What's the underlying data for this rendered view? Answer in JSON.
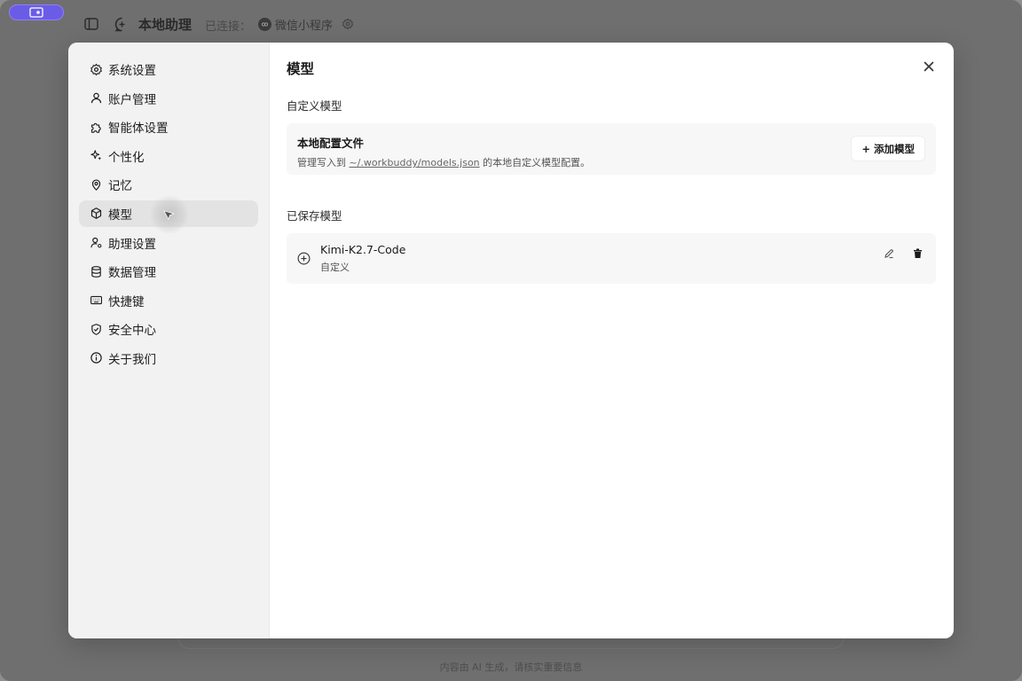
{
  "app": {
    "title": "本地助理",
    "connection_label": "已连接：",
    "connected_app": "微信小程序",
    "footer_note": "内容由 AI 生成，请核实重要信息"
  },
  "sidebar": {
    "items": [
      {
        "label": "系统设置",
        "icon": "gear-icon"
      },
      {
        "label": "账户管理",
        "icon": "user-icon"
      },
      {
        "label": "智能体设置",
        "icon": "puzzle-icon"
      },
      {
        "label": "个性化",
        "icon": "sparkle-icon"
      },
      {
        "label": "记忆",
        "icon": "pin-icon"
      },
      {
        "label": "模型",
        "icon": "cube-icon",
        "active": true
      },
      {
        "label": "助理设置",
        "icon": "user-gear-icon"
      },
      {
        "label": "数据管理",
        "icon": "database-icon"
      },
      {
        "label": "快捷键",
        "icon": "keyboard-icon"
      },
      {
        "label": "安全中心",
        "icon": "shield-icon"
      },
      {
        "label": "关于我们",
        "icon": "info-icon"
      }
    ]
  },
  "content": {
    "title": "模型",
    "custom_section_label": "自定义模型",
    "config_card": {
      "title": "本地配置文件",
      "desc_prefix": "管理写入到 ",
      "path": "~/.workbuddy/models.json",
      "desc_suffix": " 的本地自定义模型配置。",
      "add_button": "+ 添加模型"
    },
    "saved_section_label": "已保存模型",
    "saved_models": [
      {
        "name": "Kimi-K2.7-Code",
        "type": "自定义"
      }
    ]
  },
  "colors": {
    "accent": "#6b5ce7",
    "sidebar_bg": "#f2f2f2",
    "active_item_bg": "#e3e3e3",
    "card_bg": "#f7f7f8"
  }
}
